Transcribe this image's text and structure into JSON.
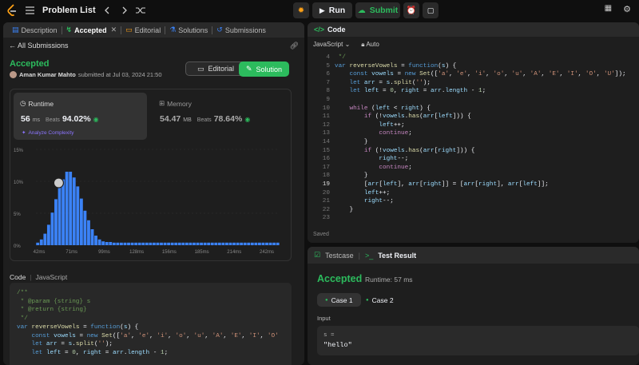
{
  "topbar": {
    "title": "Problem List",
    "run": "Run",
    "submit": "Submit"
  },
  "left_tabs": {
    "description": "Description",
    "accepted": "Accepted",
    "editorial": "Editorial",
    "solutions": "Solutions",
    "submissions": "Submissions"
  },
  "subbar": {
    "back": "All Submissions"
  },
  "result": {
    "status": "Accepted",
    "author": "Aman Kumar Mahto",
    "submitted": "submitted at Jul 03, 2024 21:50",
    "editorial_btn": "Editorial",
    "solution_btn": "Solution"
  },
  "runtime": {
    "label": "Runtime",
    "value": "56",
    "unit": "ms",
    "beats_label": "Beats",
    "beats": "94.02%",
    "analyze": "Analyze Complexity"
  },
  "memory": {
    "label": "Memory",
    "value": "54.47",
    "unit": "MB",
    "beats_label": "Beats",
    "beats": "78.64%"
  },
  "chart_data": {
    "type": "bar",
    "ytick_labels": [
      "15%",
      "10%",
      "5%",
      "0%"
    ],
    "xtick_labels": [
      "42ms",
      "71ms",
      "99ms",
      "128ms",
      "156ms",
      "185ms",
      "214ms",
      "242ms"
    ],
    "mini_tick_labels": [
      "42ms",
      "99ms",
      "156ms",
      "214ms"
    ],
    "values": [
      0.4,
      0.9,
      1.8,
      3.2,
      5.1,
      7.2,
      9.0,
      10.3,
      11.5,
      11.5,
      10.6,
      9.2,
      7.3,
      5.4,
      3.9,
      2.5,
      1.5,
      0.9,
      0.6,
      0.5,
      0.5,
      0.4,
      0.4,
      0.4,
      0.4,
      0.4,
      0.4,
      0.4,
      0.4,
      0.4,
      0.4,
      0.4,
      0.4,
      0.4,
      0.4,
      0.4,
      0.4,
      0.4,
      0.4,
      0.4,
      0.4,
      0.4,
      0.4,
      0.4,
      0.4,
      0.4,
      0.4,
      0.4,
      0.4,
      0.4,
      0.4,
      0.4,
      0.4,
      0.4,
      0.4,
      0.4,
      0.4,
      0.4,
      0.4,
      0.4,
      0.4,
      0.4,
      0.4,
      0.4,
      0.4,
      0.4,
      0.4
    ],
    "user_bar_index": 8,
    "ylim": [
      0,
      15
    ],
    "bar_color": "#3b82f6"
  },
  "code_section": {
    "label": "Code",
    "lang": "JavaScript"
  },
  "editor": {
    "title": "Code",
    "lang": "JavaScript",
    "auto": "Auto",
    "saved": "Saved",
    "line_start": 4,
    "active_line": 19
  },
  "bottom": {
    "testcase": "Testcase",
    "test_result": "Test Result",
    "status": "Accepted",
    "runtime": "Runtime: 57 ms",
    "case1": "Case 1",
    "case2": "Case 2",
    "input_label": "Input",
    "var": "s =",
    "value": "\"hello\""
  },
  "colors": {
    "accent": "#2cbb5d",
    "bg": "#1e1e1e"
  }
}
